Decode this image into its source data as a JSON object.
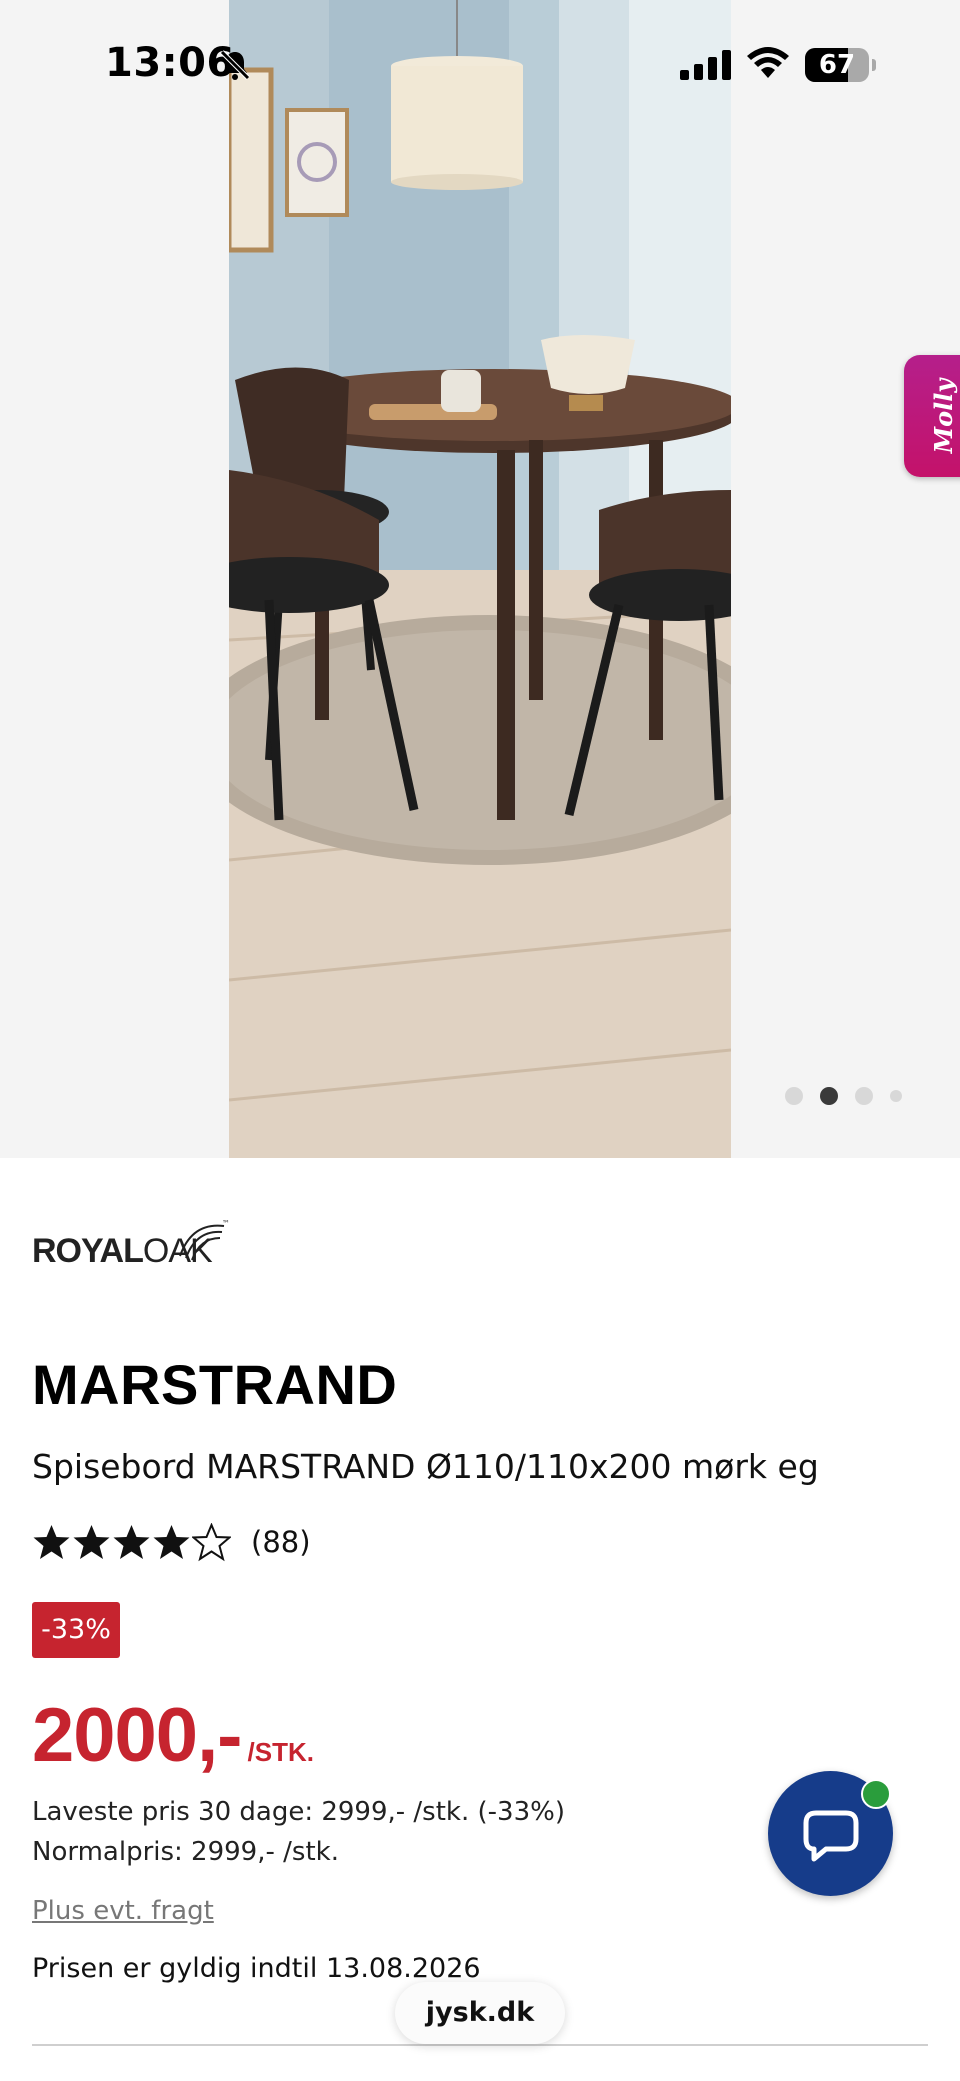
{
  "status_bar": {
    "time": "13:06",
    "battery_percent": "67",
    "battery_level": 0.67,
    "icons": [
      "bell-slash-icon",
      "cellular-signal-icon",
      "wifi-icon",
      "battery-icon"
    ]
  },
  "gallery": {
    "slide_count": 4,
    "active_index": 1,
    "image_alt": "dining-table-room-photo"
  },
  "assistant_tab": {
    "label": "Molly"
  },
  "product": {
    "brand": {
      "part1": "ROYAL",
      "part2": "OAK",
      "mark": "™"
    },
    "title": "MARSTRAND",
    "subtitle": "Spisebord MARSTRAND Ø110/110x200 mørk eg",
    "rating": {
      "value": 4,
      "max": 5,
      "count_label": "(88)"
    },
    "discount_badge": "-33%",
    "price": "2000,-",
    "price_unit": "/STK.",
    "lowest_price_30_days": "Laveste pris 30 dage: 2999,- /stk. (-33%)",
    "normal_price": "Normalpris: 2999,- /stk.",
    "shipping_link": "Plus evt. fragt",
    "validity": "Prisen er gyldig indtil 13.08.2026"
  },
  "chat": {
    "icon": "chat-bubble-icon",
    "online": true
  },
  "browser": {
    "url": "jysk.dk"
  },
  "colors": {
    "accent_red": "#c6242f",
    "chat_blue": "#163c8a",
    "molly_magenta": "#c4126a",
    "online_green": "#2a9d3c"
  }
}
